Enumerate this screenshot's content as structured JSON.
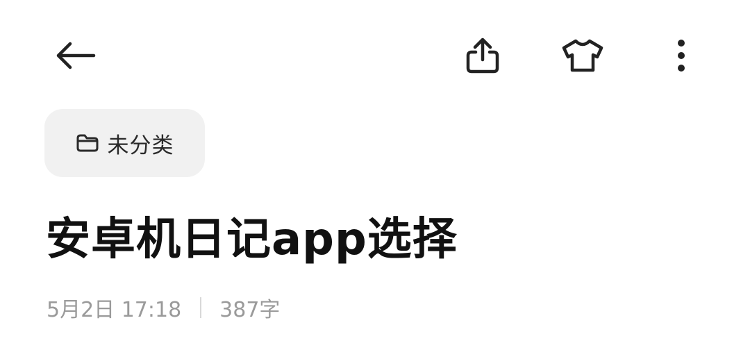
{
  "toolbar": {
    "back_icon": "arrow-left-icon",
    "share_icon": "share-icon",
    "theme_icon": "tshirt-icon",
    "more_icon": "more-vertical-icon"
  },
  "folder": {
    "icon": "folder-icon",
    "label": "未分类"
  },
  "note": {
    "title": "安卓机日记app选择",
    "date": "5月2日 17:18",
    "word_count": "387字"
  },
  "colors": {
    "background": "#ffffff",
    "chip_background": "#f1f1f1",
    "title_text": "#111111",
    "meta_text": "#9a9a9a",
    "icon": "#222222"
  }
}
